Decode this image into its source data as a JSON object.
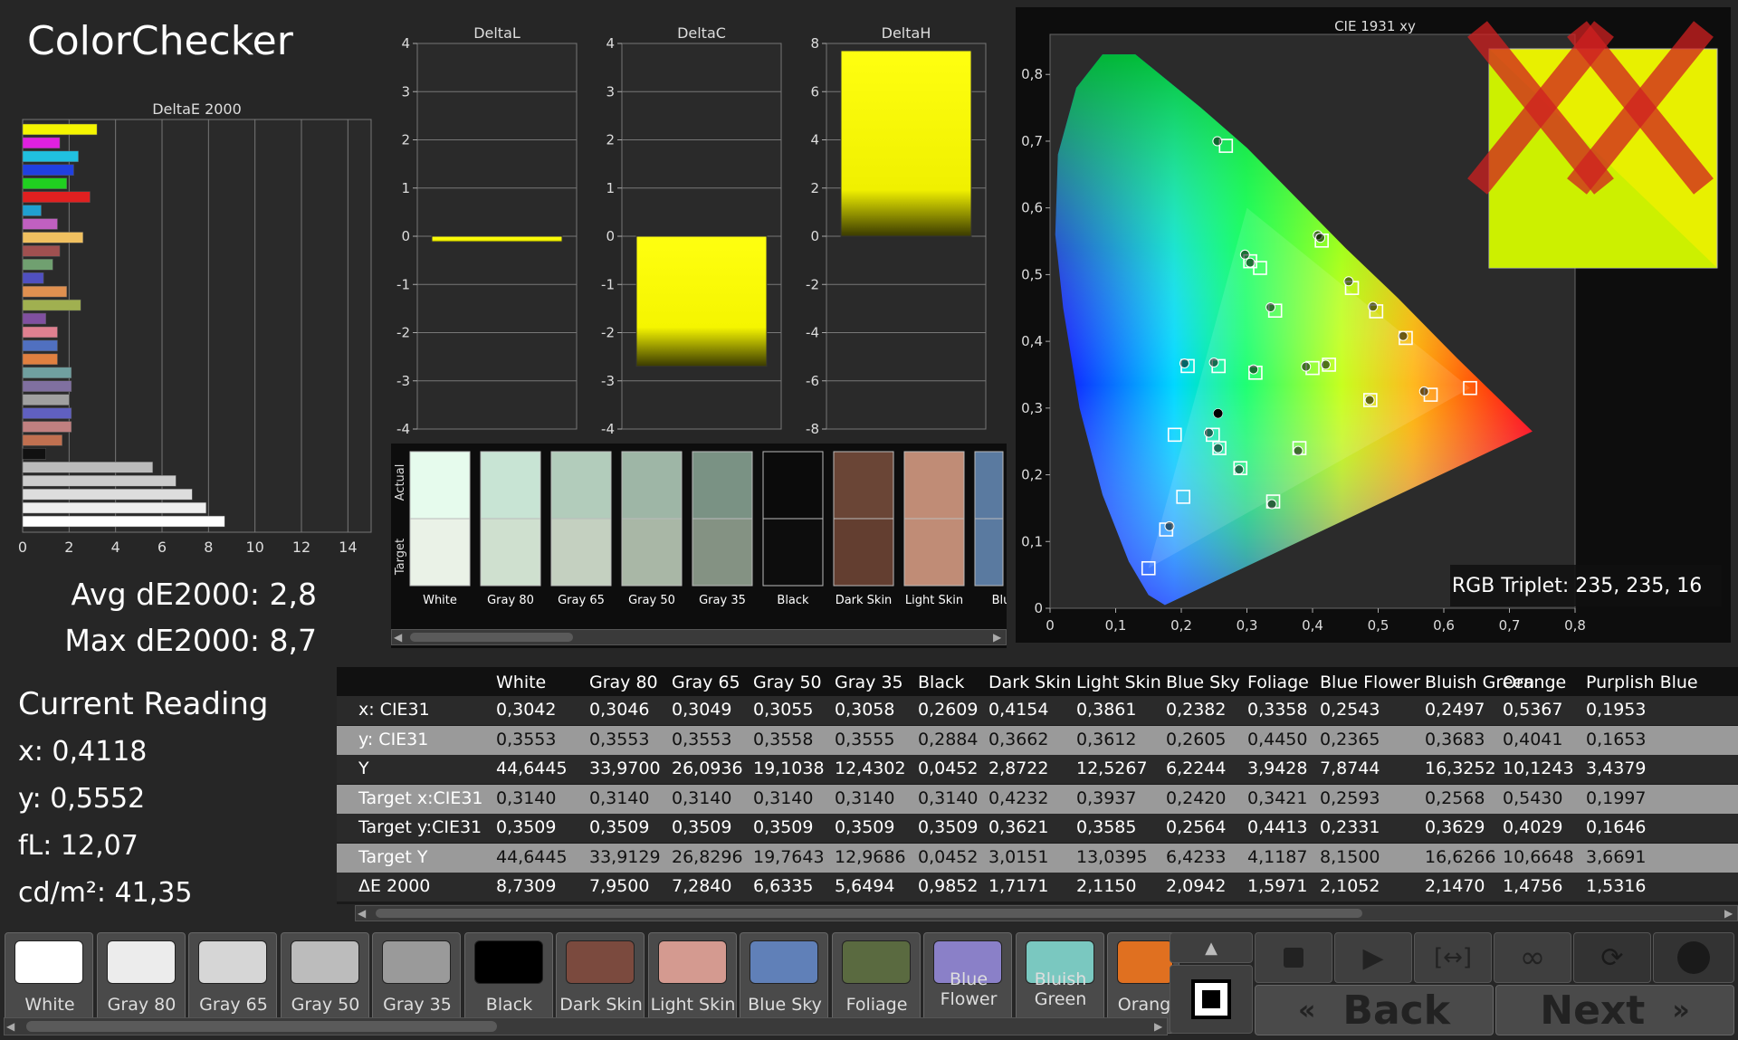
{
  "app": {
    "title": "ColorChecker"
  },
  "summary": {
    "avg": "Avg dE2000: 2,8",
    "max": "Max dE2000: 8,7"
  },
  "current": {
    "title": "Current Reading",
    "x": "x: 0,4118",
    "y": "y: 0,5552",
    "fl": "fL: 12,07",
    "cdm2": "cd/m²: 41,35"
  },
  "colors": {
    "accent_yellow": "#f0f000",
    "panel": "#262626",
    "dark": "#0d0d0d"
  },
  "deltae_chart": {
    "title": "DeltaE 2000",
    "ticks": [
      "0",
      "2",
      "4",
      "6",
      "8",
      "10",
      "12",
      "14"
    ],
    "bars": [
      {
        "value": 3.2,
        "color": "#f5f500"
      },
      {
        "value": 1.6,
        "color": "#e020e0"
      },
      {
        "value": 2.4,
        "color": "#20c0e0"
      },
      {
        "value": 2.2,
        "color": "#2040e0"
      },
      {
        "value": 1.9,
        "color": "#20d020"
      },
      {
        "value": 2.9,
        "color": "#e02020"
      },
      {
        "value": 0.8,
        "color": "#20a0d0"
      },
      {
        "value": 1.5,
        "color": "#c060c0"
      },
      {
        "value": 2.6,
        "color": "#f0c060"
      },
      {
        "value": 1.6,
        "color": "#a05050"
      },
      {
        "value": 1.3,
        "color": "#70a070"
      },
      {
        "value": 0.9,
        "color": "#5050c0"
      },
      {
        "value": 1.9,
        "color": "#e09050"
      },
      {
        "value": 2.5,
        "color": "#a0b050"
      },
      {
        "value": 1.0,
        "color": "#8050a0"
      },
      {
        "value": 1.5,
        "color": "#e08090"
      },
      {
        "value": 1.5,
        "color": "#5070c0"
      },
      {
        "value": 1.5,
        "color": "#e08040"
      },
      {
        "value": 2.1,
        "color": "#70a0a0"
      },
      {
        "value": 2.1,
        "color": "#8070a0"
      },
      {
        "value": 2.0,
        "color": "#a0a0a0"
      },
      {
        "value": 2.1,
        "color": "#6060c0"
      },
      {
        "value": 2.1,
        "color": "#c08080"
      },
      {
        "value": 1.7,
        "color": "#c07050"
      },
      {
        "value": 1.0,
        "color": "#111111"
      },
      {
        "value": 5.6,
        "color": "#bbbbbb"
      },
      {
        "value": 6.6,
        "color": "#cccccc"
      },
      {
        "value": 7.3,
        "color": "#dddddd"
      },
      {
        "value": 7.9,
        "color": "#eeeeee"
      },
      {
        "value": 8.7,
        "color": "#ffffff"
      }
    ]
  },
  "delta_charts": [
    {
      "title": "DeltaL",
      "ticks": [
        "4",
        "3",
        "2",
        "1",
        "0",
        "-1",
        "-2",
        "-3",
        "-4"
      ],
      "min": -4,
      "max": 4,
      "value": -0.12
    },
    {
      "title": "DeltaC",
      "ticks": [
        "4",
        "3",
        "2",
        "1",
        "0",
        "-1",
        "-2",
        "-3",
        "-4"
      ],
      "min": -4,
      "max": 4,
      "value": -2.7
    },
    {
      "title": "DeltaH",
      "ticks": [
        "8",
        "6",
        "4",
        "2",
        "0",
        "-2",
        "-4",
        "-6",
        "-8"
      ],
      "min": -8,
      "max": 8,
      "value": 7.7
    }
  ],
  "swatch_strip": {
    "actual_label": "Actual",
    "target_label": "Target",
    "items": [
      {
        "name": "White",
        "actual": "#e6fbed",
        "target": "#eaf2e7"
      },
      {
        "name": "Gray 80",
        "actual": "#c8e4d4",
        "target": "#cfe0cf"
      },
      {
        "name": "Gray 65",
        "actual": "#b2ccbb",
        "target": "#c4d0c0"
      },
      {
        "name": "Gray 50",
        "actual": "#9eb6a6",
        "target": "#a9b7a6"
      },
      {
        "name": "Gray 35",
        "actual": "#7a9284",
        "target": "#849283"
      },
      {
        "name": "Black",
        "actual": "#0b0b0b",
        "target": "#0d0d0d"
      },
      {
        "name": "Dark Skin",
        "actual": "#6a4536",
        "target": "#633e30"
      },
      {
        "name": "Light Skin",
        "actual": "#c08c76",
        "target": "#c08c76"
      },
      {
        "name": "Blue",
        "actual": "#5a7aa0",
        "target": "#5a7aa0"
      }
    ]
  },
  "cie": {
    "title": "CIE 1931 xy",
    "x_ticks": [
      "0",
      "0,1",
      "0,2",
      "0,3",
      "0,4",
      "0,5",
      "0,6",
      "0,7",
      "0,8"
    ],
    "y_ticks": [
      "0",
      "0,1",
      "0,2",
      "0,3",
      "0,4",
      "0,5",
      "0,6",
      "0,7",
      "0,8"
    ],
    "rgb_triplet": "RGB Triplet: 235, 235, 16",
    "targets": [
      [
        0.268,
        0.693
      ],
      [
        0.414,
        0.551
      ],
      [
        0.305,
        0.52
      ],
      [
        0.32,
        0.51
      ],
      [
        0.46,
        0.48
      ],
      [
        0.497,
        0.445
      ],
      [
        0.542,
        0.405
      ],
      [
        0.64,
        0.33
      ],
      [
        0.58,
        0.32
      ],
      [
        0.4,
        0.36
      ],
      [
        0.425,
        0.365
      ],
      [
        0.313,
        0.353
      ],
      [
        0.343,
        0.446
      ],
      [
        0.2568,
        0.3629
      ],
      [
        0.2097,
        0.363
      ],
      [
        0.19,
        0.26
      ],
      [
        0.248,
        0.26
      ],
      [
        0.258,
        0.24
      ],
      [
        0.29,
        0.21
      ],
      [
        0.38,
        0.24
      ],
      [
        0.34,
        0.16
      ],
      [
        0.203,
        0.167
      ],
      [
        0.177,
        0.118
      ],
      [
        0.15,
        0.06
      ],
      [
        0.488,
        0.312
      ]
    ],
    "actuals": [
      [
        0.255,
        0.7
      ],
      [
        0.408,
        0.559
      ],
      [
        0.297,
        0.53
      ],
      [
        0.305,
        0.518
      ],
      [
        0.455,
        0.49
      ],
      [
        0.492,
        0.452
      ],
      [
        0.538,
        0.408
      ],
      [
        0.57,
        0.325
      ],
      [
        0.42,
        0.365
      ],
      [
        0.39,
        0.362
      ],
      [
        0.31,
        0.358
      ],
      [
        0.336,
        0.451
      ],
      [
        0.2497,
        0.3683
      ],
      [
        0.2048,
        0.367
      ],
      [
        0.242,
        0.263
      ],
      [
        0.256,
        0.24
      ],
      [
        0.288,
        0.208
      ],
      [
        0.378,
        0.236
      ],
      [
        0.338,
        0.156
      ],
      [
        0.182,
        0.123
      ],
      [
        0.4118,
        0.5552
      ],
      [
        0.487,
        0.312
      ],
      [
        0.256,
        0.292
      ]
    ]
  },
  "table": {
    "columns": [
      "White",
      "Gray 80",
      "Gray 65",
      "Gray 50",
      "Gray 35",
      "Black",
      "Dark Skin",
      "Light Skin",
      "Blue Sky",
      "Foliage",
      "Blue Flower",
      "Bluish Green",
      "Orange",
      "Purplish Blue"
    ],
    "rows": [
      {
        "label": "x: CIE31",
        "values": [
          "0,3042",
          "0,3046",
          "0,3049",
          "0,3055",
          "0,3058",
          "0,2609",
          "0,4154",
          "0,3861",
          "0,2382",
          "0,3358",
          "0,2543",
          "0,2497",
          "0,5367",
          "0,1953"
        ]
      },
      {
        "label": "y: CIE31",
        "values": [
          "0,3553",
          "0,3553",
          "0,3553",
          "0,3558",
          "0,3555",
          "0,2884",
          "0,3662",
          "0,3612",
          "0,2605",
          "0,4450",
          "0,2365",
          "0,3683",
          "0,4041",
          "0,1653"
        ]
      },
      {
        "label": "Y",
        "values": [
          "44,6445",
          "33,9700",
          "26,0936",
          "19,1038",
          "12,4302",
          "0,0452",
          "2,8722",
          "12,5267",
          "6,2244",
          "3,9428",
          "7,8744",
          "16,3252",
          "10,1243",
          "3,4379"
        ]
      },
      {
        "label": "Target x:CIE31",
        "values": [
          "0,3140",
          "0,3140",
          "0,3140",
          "0,3140",
          "0,3140",
          "0,3140",
          "0,4232",
          "0,3937",
          "0,2420",
          "0,3421",
          "0,2593",
          "0,2568",
          "0,5430",
          "0,1997"
        ]
      },
      {
        "label": "Target y:CIE31",
        "values": [
          "0,3509",
          "0,3509",
          "0,3509",
          "0,3509",
          "0,3509",
          "0,3509",
          "0,3621",
          "0,3585",
          "0,2564",
          "0,4413",
          "0,2331",
          "0,3629",
          "0,4029",
          "0,1646"
        ]
      },
      {
        "label": "Target Y",
        "values": [
          "44,6445",
          "33,9129",
          "26,8296",
          "19,7643",
          "12,9686",
          "0,0452",
          "3,0151",
          "13,0395",
          "6,4233",
          "4,1187",
          "8,1500",
          "16,6266",
          "10,6648",
          "3,6691"
        ]
      },
      {
        "label": "ΔE 2000",
        "values": [
          "8,7309",
          "7,9500",
          "7,2840",
          "6,6335",
          "5,6494",
          "0,9852",
          "1,7171",
          "2,1150",
          "2,0942",
          "1,5971",
          "2,1052",
          "2,1470",
          "1,4756",
          "1,5316"
        ]
      }
    ]
  },
  "tiles": [
    {
      "label": "White",
      "color": "#ffffff"
    },
    {
      "label": "Gray 80",
      "color": "#ececec"
    },
    {
      "label": "Gray 65",
      "color": "#d6d6d6"
    },
    {
      "label": "Gray 50",
      "color": "#bcbcbc"
    },
    {
      "label": "Gray 35",
      "color": "#9a9a9a"
    },
    {
      "label": "Black",
      "color": "#000000"
    },
    {
      "label": "Dark Skin",
      "color": "#7b4a3e"
    },
    {
      "label": "Light Skin",
      "color": "#d49a90"
    },
    {
      "label": "Blue Sky",
      "color": "#6080b8"
    },
    {
      "label": "Foliage",
      "color": "#5a6a40"
    },
    {
      "label": "Blue\nFlower",
      "color": "#8a80c8"
    },
    {
      "label": "Bluish\nGreen",
      "color": "#7ac8c0"
    },
    {
      "label": "Orang",
      "color": "#e07020"
    }
  ],
  "controls": {
    "back": "Back",
    "next": "Next"
  }
}
